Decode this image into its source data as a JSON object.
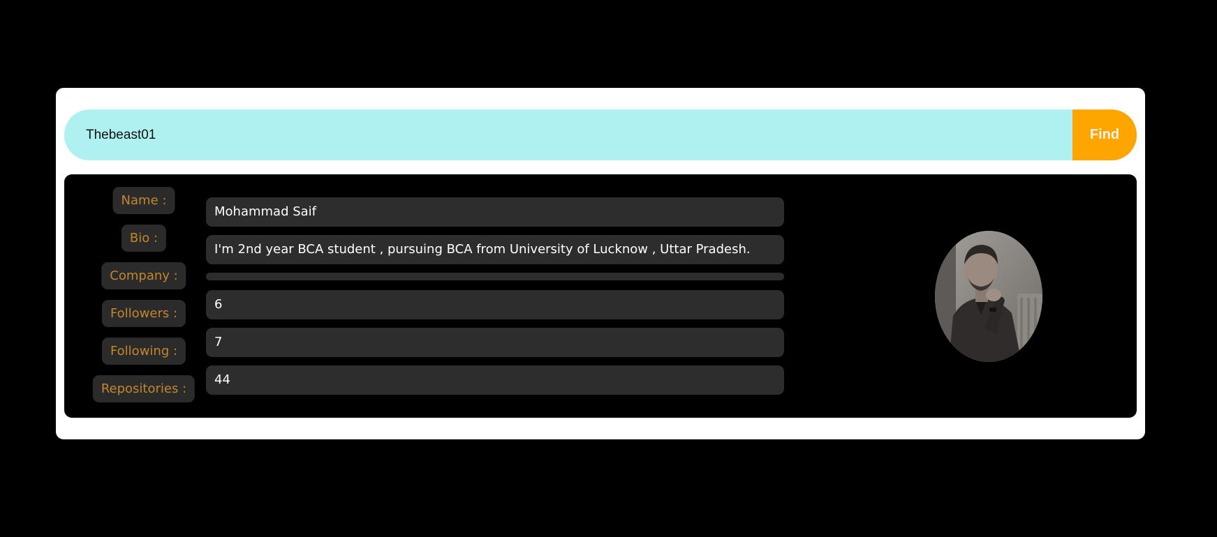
{
  "search": {
    "value": "Thebeast01",
    "button_label": "Find"
  },
  "profile": {
    "labels": {
      "name": "Name :",
      "bio": "Bio :",
      "company": "Company :",
      "followers": "Followers :",
      "following": "Following :",
      "repositories": "Repositories :"
    },
    "values": {
      "name": "Mohammad Saif",
      "bio": "I'm 2nd year BCA student , pursuing BCA from University of Lucknow , Uttar Pradesh.",
      "company": "",
      "followers": "6",
      "following": "7",
      "repositories": "44"
    }
  },
  "colors": {
    "page_background": "#000000",
    "card_background": "#ffffff",
    "search_background": "#aff0f0",
    "button_background": "#ffa500",
    "label_text": "#c3862a",
    "pill_background": "#2b2b2b"
  }
}
